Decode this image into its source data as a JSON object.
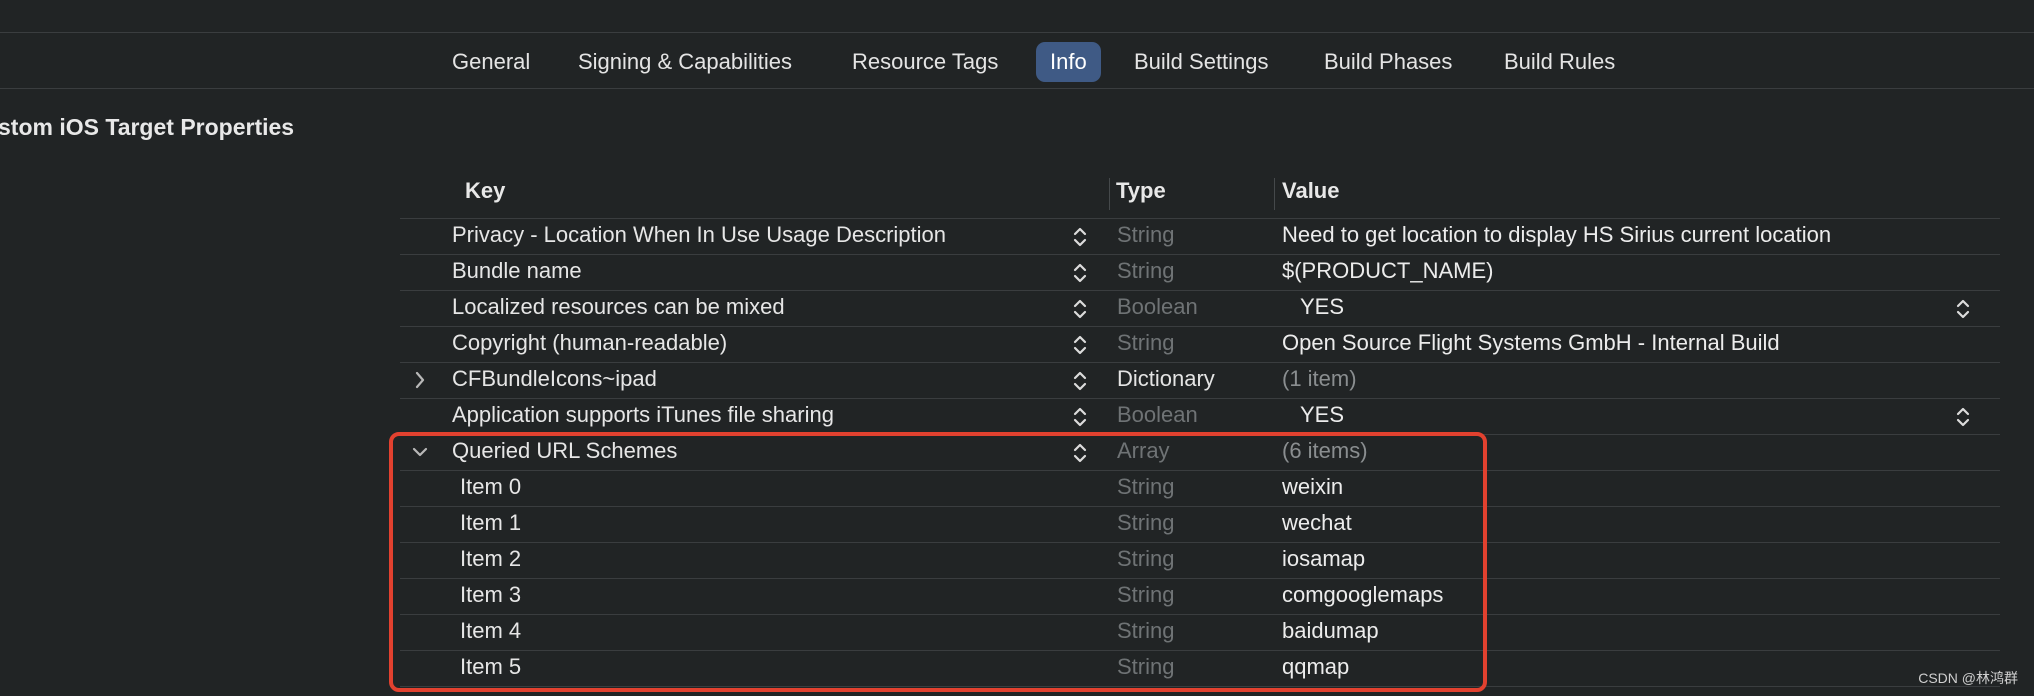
{
  "tabs": [
    {
      "label": "General",
      "active": false
    },
    {
      "label": "Signing & Capabilities",
      "active": false
    },
    {
      "label": "Resource Tags",
      "active": false
    },
    {
      "label": "Info",
      "active": true
    },
    {
      "label": "Build Settings",
      "active": false
    },
    {
      "label": "Build Phases",
      "active": false
    },
    {
      "label": "Build Rules",
      "active": false
    }
  ],
  "section_title": "stom iOS Target Properties",
  "table": {
    "headers": {
      "key": "Key",
      "type": "Type",
      "value": "Value"
    },
    "rows": [
      {
        "key": "Privacy - Location When In Use Usage Description",
        "type": "String",
        "value": "Need to get location to display HS Sirius current location"
      },
      {
        "key": "Bundle name",
        "type": "String",
        "value": "$(PRODUCT_NAME)"
      },
      {
        "key": "Localized resources can be mixed",
        "type": "Boolean",
        "value": "YES"
      },
      {
        "key": "Copyright (human-readable)",
        "type": "String",
        "value": "Open Source Flight Systems GmbH - Internal Build"
      },
      {
        "key": "CFBundleIcons~ipad",
        "type": "Dictionary",
        "value": "(1 item)"
      },
      {
        "key": "Application supports iTunes file sharing",
        "type": "Boolean",
        "value": "YES"
      },
      {
        "key": "Queried URL Schemes",
        "type": "Array",
        "value": "(6 items)"
      },
      {
        "key": "Item 0",
        "type": "String",
        "value": "weixin"
      },
      {
        "key": "Item 1",
        "type": "String",
        "value": "wechat"
      },
      {
        "key": "Item 2",
        "type": "String",
        "value": "iosamap"
      },
      {
        "key": "Item 3",
        "type": "String",
        "value": "comgooglemaps"
      },
      {
        "key": "Item 4",
        "type": "String",
        "value": "baidumap"
      },
      {
        "key": "Item 5",
        "type": "String",
        "value": "qqmap"
      }
    ]
  },
  "watermark": "CSDN @林鸿群",
  "colors": {
    "background": "#212425",
    "active_tab": "#3f5a85",
    "highlight_box": "#e2412f"
  }
}
